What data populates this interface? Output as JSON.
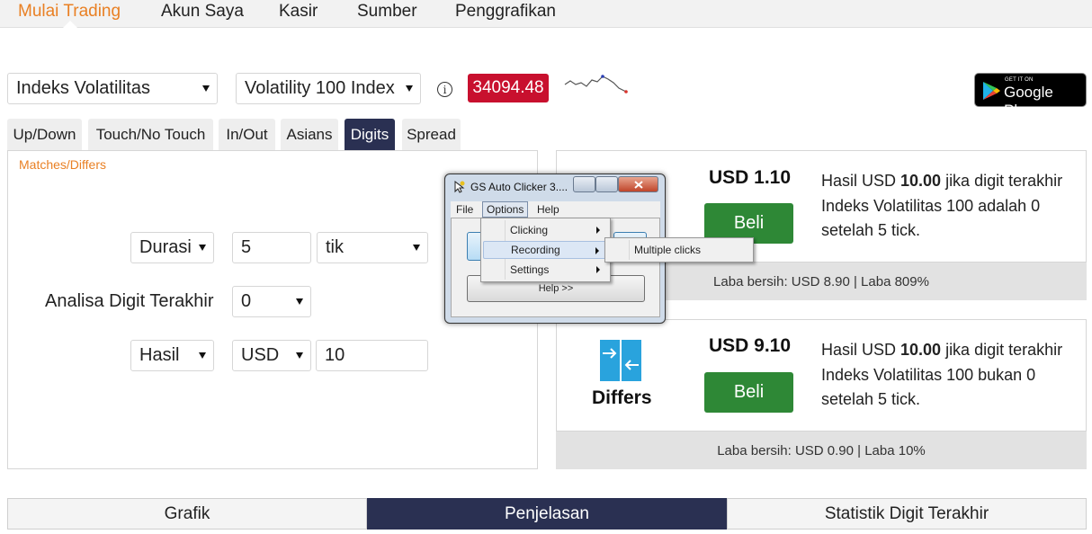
{
  "nav": {
    "items": [
      "Mulai Trading",
      "Akun Saya",
      "Kasir",
      "Sumber",
      "Penggrafikan"
    ],
    "active": "Mulai Trading",
    "accent_color": "#e98024"
  },
  "market": {
    "category": "Indeks Volatilitas",
    "symbol": "Volatility 100 Index",
    "price": "34094.48",
    "price_color": "#c8102e"
  },
  "store_badge": {
    "small": "GET IT ON",
    "big": "Google Play"
  },
  "contract_tabs": [
    "Up/Down",
    "Touch/No Touch",
    "In/Out",
    "Asians",
    "Digits",
    "Spread"
  ],
  "active_tab": "Digits",
  "form": {
    "subtitle": "Matches/Differs",
    "duration_label": "Durasi",
    "duration_value": "5",
    "duration_unit": "tik",
    "digit_label": "Analisa Digit Terakhir",
    "digit_value": "0",
    "payout_type": "Hasil",
    "currency": "USD",
    "amount": "10"
  },
  "cards": [
    {
      "price": "USD 1.10",
      "buy_label": "Beli",
      "desc_pre": "Hasil USD ",
      "desc_amount": "10.00",
      "desc_post": " jika digit terakhir Indeks Volatilitas 100 adalah 0 setelah 5 tick.",
      "footer": "Laba bersih: USD 8.90 | Laba 809%"
    },
    {
      "title": "Differs",
      "price": "USD 9.10",
      "buy_label": "Beli",
      "desc_pre": "Hasil USD ",
      "desc_amount": "10.00",
      "desc_post": " jika digit terakhir Indeks Volatilitas 100 bukan 0 setelah 5 tick.",
      "footer": "Laba bersih: USD 0.90 | Laba 10%"
    }
  ],
  "bottom_tabs": [
    "Grafik",
    "Penjelasan",
    "Statistik Digit Terakhir"
  ],
  "bottom_active": "Penjelasan",
  "popup": {
    "title": "GS Auto Clicker 3....",
    "menu": [
      "File",
      "Options",
      "Help"
    ],
    "options_menu": [
      "Clicking",
      "Recording",
      "Settings"
    ],
    "recording_submenu": [
      "Multiple clicks"
    ],
    "help_button": "Help >>"
  },
  "colors": {
    "dark_navy": "#2a3052",
    "buy_green": "#2e8836",
    "differs_icon": "#29a3dd"
  }
}
